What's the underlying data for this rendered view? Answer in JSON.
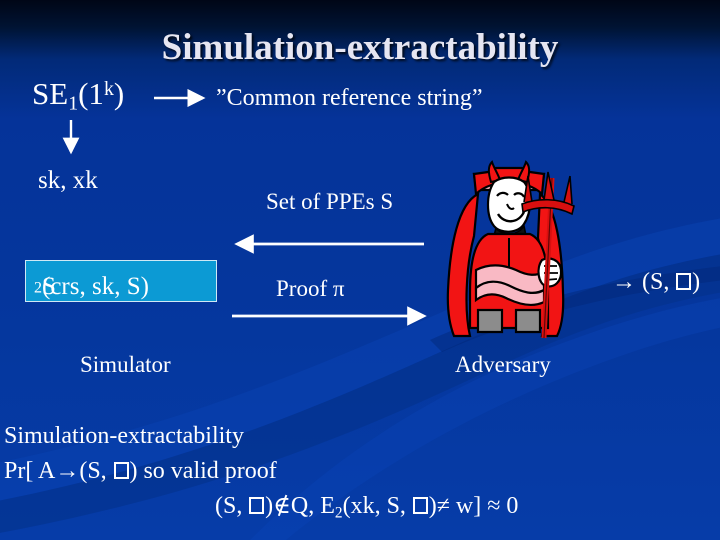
{
  "slide": {
    "title": "Simulation-extractability",
    "background_color": "#053399",
    "title_color": "#e6e6f2",
    "accent_box_color": "#0c9ad4",
    "devil_color": "#ff0000"
  },
  "diagram": {
    "se1_label_pre": "SE",
    "se1_sub": "1",
    "se1_mid": "(1",
    "se1_sup": "k",
    "se1_post": ")",
    "crs_label": "”Common reference string”",
    "keys_label": "sk, xk",
    "ppes_label": "Set of PPEs S",
    "proof_label": "Proof π",
    "s2_pre": "S",
    "s2_sub": "2",
    "s2_post": "(crs, sk, S)",
    "output_arrow": "→",
    "output_label_pre": "(S, ",
    "output_label_post": ")",
    "simulator_label": "Simulator",
    "adversary_label": "Adversary"
  },
  "formula": {
    "line1": "Simulation-extractability",
    "line2_a": "Pr[ A",
    "line2_arrow": "→",
    "line2_b": "(S, ",
    "line2_c": ") so valid proof",
    "line3_a": "(S, ",
    "line3_b": ")",
    "line3_notin": "∉",
    "line3_c": "Q, E",
    "line3_sub": "2",
    "line3_d": "(xk, S, ",
    "line3_e": ")",
    "line3_neq": "≠",
    "line3_f": " w] ≈ 0"
  },
  "icons": {
    "devil": "devil-adversary-icon",
    "arrow_down": "arrow-down-icon",
    "arrow_right": "arrow-right-icon",
    "arrow_left": "arrow-left-icon"
  }
}
